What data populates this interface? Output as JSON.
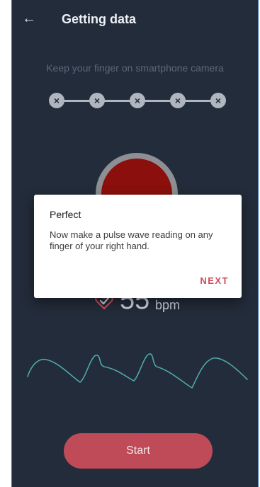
{
  "app_bar": {
    "back_icon": "arrow-left-icon",
    "title": "Getting data"
  },
  "instruction": "Keep your finger on smartphone camera",
  "progress": {
    "steps": [
      "×",
      "×",
      "×",
      "×",
      "×"
    ],
    "step_icon": "x-mark-icon"
  },
  "sensor": {
    "fill_color": "#8b0f0c",
    "ring_color": "#8d8f94"
  },
  "reading": {
    "heart_icon": "heart-check-icon",
    "value": "55",
    "unit": "bpm"
  },
  "colors": {
    "background": "#232c3a",
    "accent": "#bf4a58",
    "wave": "#4fa8a3"
  },
  "start_button": {
    "label": "Start"
  },
  "dialog": {
    "title": "Perfect",
    "body": "Now make a pulse wave reading on any finger of your right hand.",
    "action": "NEXT"
  }
}
